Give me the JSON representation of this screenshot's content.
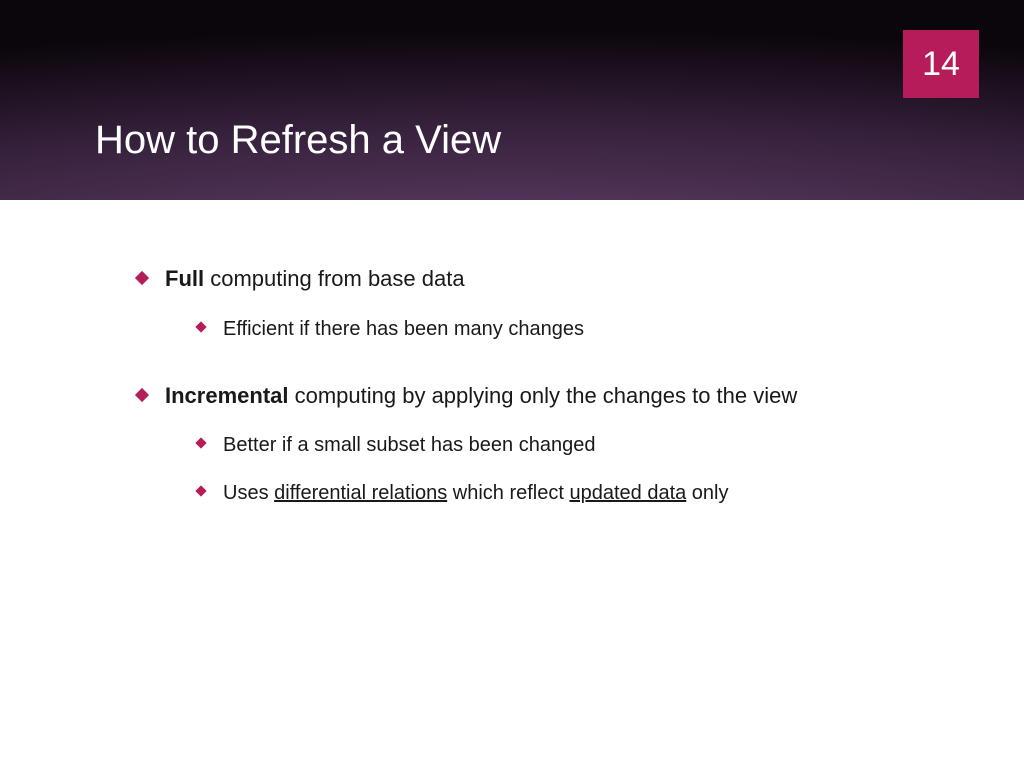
{
  "page_number": "14",
  "title": "How to Refresh a View",
  "b1_bold": "Full",
  "b1_rest": " computing from base data",
  "b1_s1": "Efficient if there has been many changes",
  "b2_bold": "Incremental",
  "b2_rest": " computing by applying only the changes to the view",
  "b2_s1": "Better if a small subset has been changed",
  "b2_s2_a": "Uses ",
  "b2_s2_u1": "differential relations",
  "b2_s2_b": " which reflect ",
  "b2_s2_u2": "updated data",
  "b2_s2_c": " only"
}
